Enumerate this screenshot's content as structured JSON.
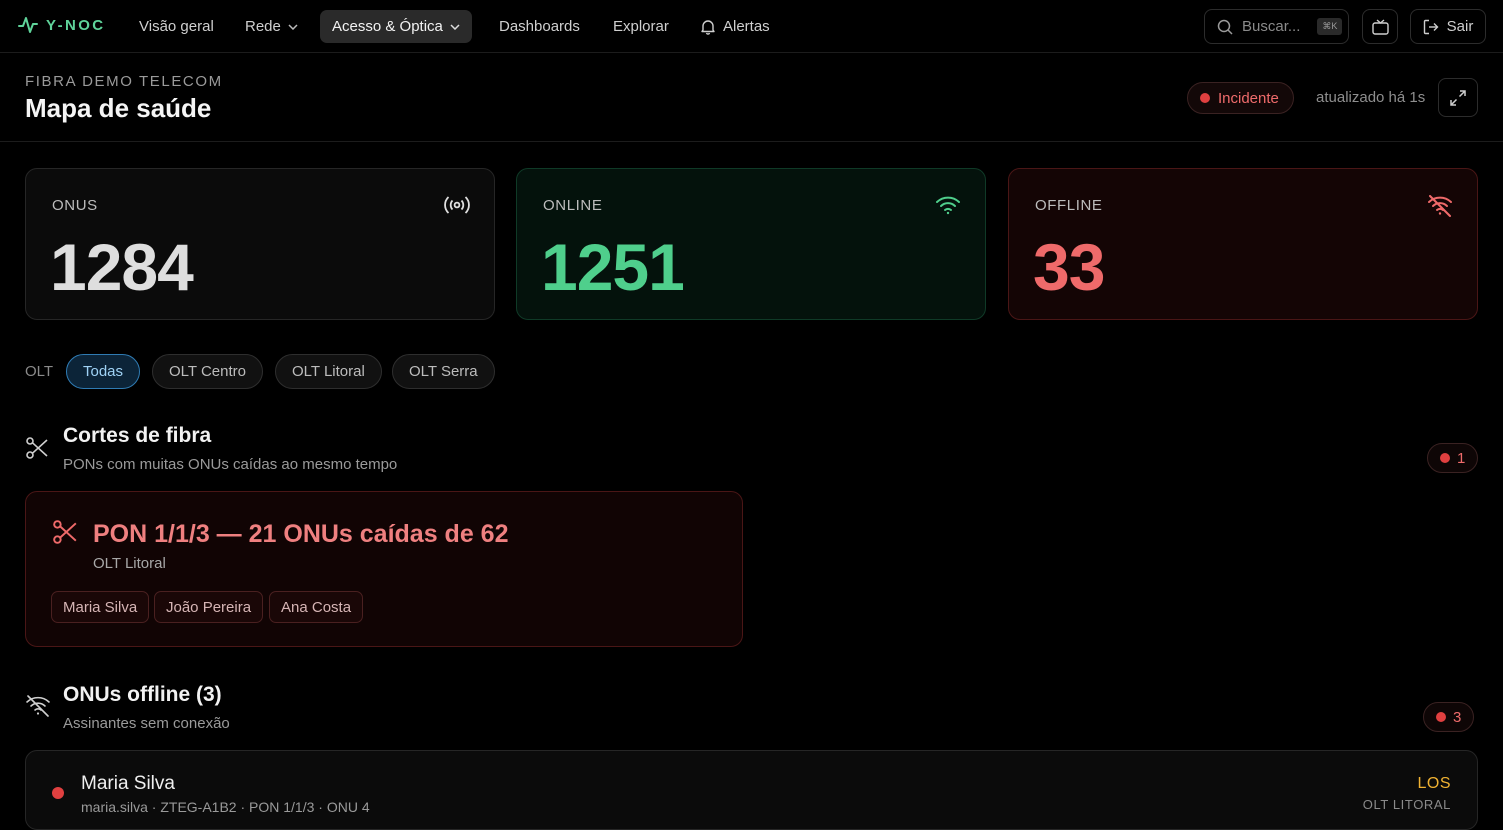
{
  "nav": {
    "brand": "Y-NOC",
    "items": [
      {
        "label": "Visão geral"
      },
      {
        "label": "Rede"
      },
      {
        "label": "Acesso & Óptica"
      },
      {
        "label": "Dashboards"
      },
      {
        "label": "Explorar"
      },
      {
        "label": "Alertas"
      }
    ],
    "search_placeholder": "Buscar...",
    "search_shortcut": "⌘K",
    "logout_label": "Sair"
  },
  "header": {
    "org": "FIBRA DEMO TELECOM",
    "title": "Mapa de saúde",
    "status_label": "Incidente",
    "updated": "atualizado há 1s"
  },
  "stats": [
    {
      "label": "ONUS",
      "value": "1284",
      "icon": "broadcast-icon"
    },
    {
      "label": "ONLINE",
      "value": "1251",
      "icon": "wifi-icon"
    },
    {
      "label": "OFFLINE",
      "value": "33",
      "icon": "wifi-off-icon"
    }
  ],
  "filters": {
    "label": "OLT",
    "options": [
      "Todas",
      "OLT Centro",
      "OLT Litoral",
      "OLT Serra"
    ],
    "selected": "Todas"
  },
  "fiber_cuts": {
    "title": "Cortes de fibra",
    "subtitle": "PONs com muitas ONUs caídas ao mesmo tempo",
    "count": "1",
    "items": [
      {
        "title": "PON 1/1/3 — 21 ONUs caídas de 62",
        "olt": "OLT Litoral",
        "subscribers": [
          "Maria Silva",
          "João Pereira",
          "Ana Costa"
        ]
      }
    ]
  },
  "offline_onus": {
    "title": "ONUs offline (3)",
    "subtitle": "Assinantes sem conexão",
    "count": "3",
    "rows": [
      {
        "name": "Maria Silva",
        "meta": "maria.silva · ZTEG-A1B2 · PON 1/1/3 · ONU 4",
        "status": "LOS",
        "olt": "OLT LITORAL"
      }
    ]
  },
  "colors": {
    "accent_green": "#4fcf8c",
    "alert_red": "#ef6a6a",
    "warning_amber": "#f0b232",
    "filter_blue": "#2f7bb3"
  }
}
